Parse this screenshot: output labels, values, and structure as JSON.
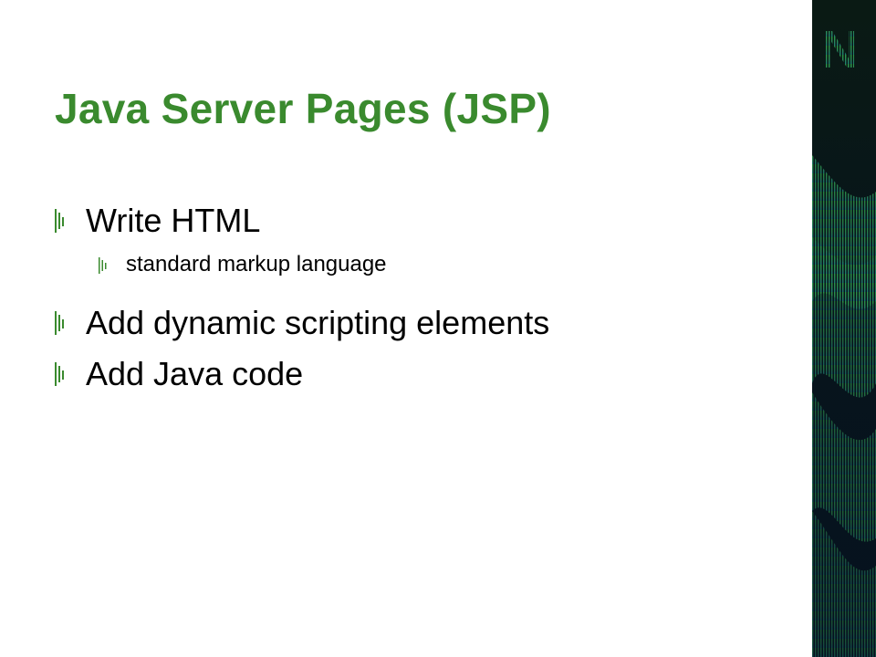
{
  "slide": {
    "title": "Java Server Pages (JSP)",
    "bullets": [
      {
        "level": 1,
        "text": "Write HTML"
      },
      {
        "level": 2,
        "text": "standard markup language"
      },
      {
        "level": 1,
        "text": "Add dynamic scripting elements"
      },
      {
        "level": 1,
        "text": "Add Java code"
      }
    ],
    "bullet_icon": "vertical-bars-icon",
    "colors": {
      "title": "#3a8a2e",
      "bullet_marker": "#3a8a2e",
      "sidebar_dark": "#06121f",
      "sidebar_green": "#2f9a46",
      "sidebar_teal": "#1f7a78"
    }
  }
}
